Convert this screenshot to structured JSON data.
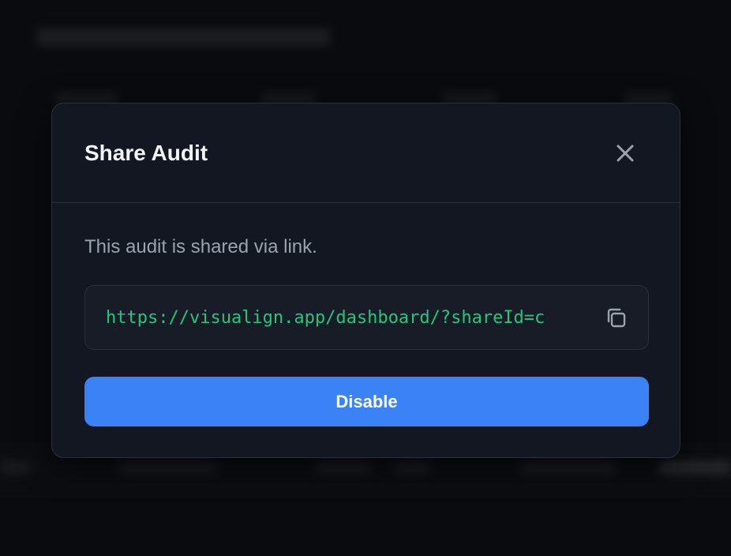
{
  "modal": {
    "title": "Share Audit",
    "description": "This audit is shared via link.",
    "share_link": "https://visualign.app/dashboard/?shareId=c",
    "disable_label": "Disable"
  },
  "icons": {
    "close": "close-icon",
    "copy": "copy-icon"
  },
  "colors": {
    "accent": "#3b82f6",
    "link": "#22c77b",
    "modal_bg": "#121722",
    "backdrop": "#0a0b0e"
  }
}
